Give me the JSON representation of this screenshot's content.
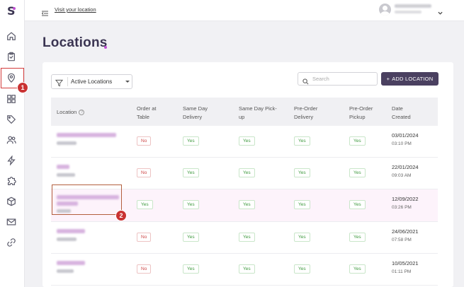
{
  "app": {
    "logo": "S"
  },
  "sidebar": {
    "items": [
      {
        "name": "home-icon"
      },
      {
        "name": "clipboard-icon"
      },
      {
        "name": "location-pin-icon",
        "active": true
      },
      {
        "name": "grid-icon"
      },
      {
        "name": "tag-icon"
      },
      {
        "name": "users-icon"
      },
      {
        "name": "lightning-icon"
      },
      {
        "name": "puzzle-icon"
      },
      {
        "name": "box-icon"
      },
      {
        "name": "mail-icon"
      },
      {
        "name": "link-icon"
      }
    ]
  },
  "annotations": {
    "marker1": "1",
    "marker2": "2",
    "color": "#c93232"
  },
  "topbar": {
    "visit_link": "Visit your location"
  },
  "page": {
    "title": "Locations",
    "accent": "#c14fd3"
  },
  "toolbar": {
    "filter_value": "Active Locations",
    "search_placeholder": "Search",
    "add_button": "ADD LOCATION",
    "add_button_icon": "plus-icon"
  },
  "table": {
    "headers": {
      "location": "Location",
      "order_at_table": [
        "Order at",
        "Table"
      ],
      "same_day_delivery": [
        "Same Day",
        "Delivery"
      ],
      "same_day_pickup": [
        "Same Day Pick-",
        "up"
      ],
      "pre_order_delivery": [
        "Pre-Order",
        "Delivery"
      ],
      "pre_order_pickup": [
        "Pre-Order",
        "Pickup"
      ],
      "date_created": [
        "Date",
        "Created"
      ]
    },
    "rows": [
      {
        "order_at_table": "No",
        "same_day_delivery": "Yes",
        "same_day_pickup": "Yes",
        "pre_order_delivery": "Yes",
        "pre_order_pickup": "Yes",
        "date": "03/01/2024",
        "time": "03:10 PM"
      },
      {
        "order_at_table": "No",
        "same_day_delivery": "Yes",
        "same_day_pickup": "Yes",
        "pre_order_delivery": "Yes",
        "pre_order_pickup": "Yes",
        "date": "22/01/2024",
        "time": "09:03 AM"
      },
      {
        "order_at_table": "Yes",
        "same_day_delivery": "Yes",
        "same_day_pickup": "Yes",
        "pre_order_delivery": "Yes",
        "pre_order_pickup": "Yes",
        "date": "12/09/2022",
        "time": "03:26 PM"
      },
      {
        "order_at_table": "No",
        "same_day_delivery": "Yes",
        "same_day_pickup": "Yes",
        "pre_order_delivery": "Yes",
        "pre_order_pickup": "Yes",
        "date": "24/06/2021",
        "time": "07:58 PM"
      },
      {
        "order_at_table": "No",
        "same_day_delivery": "Yes",
        "same_day_pickup": "Yes",
        "pre_order_delivery": "Yes",
        "pre_order_pickup": "Yes",
        "date": "10/05/2021",
        "time": "01:11 PM"
      }
    ]
  }
}
